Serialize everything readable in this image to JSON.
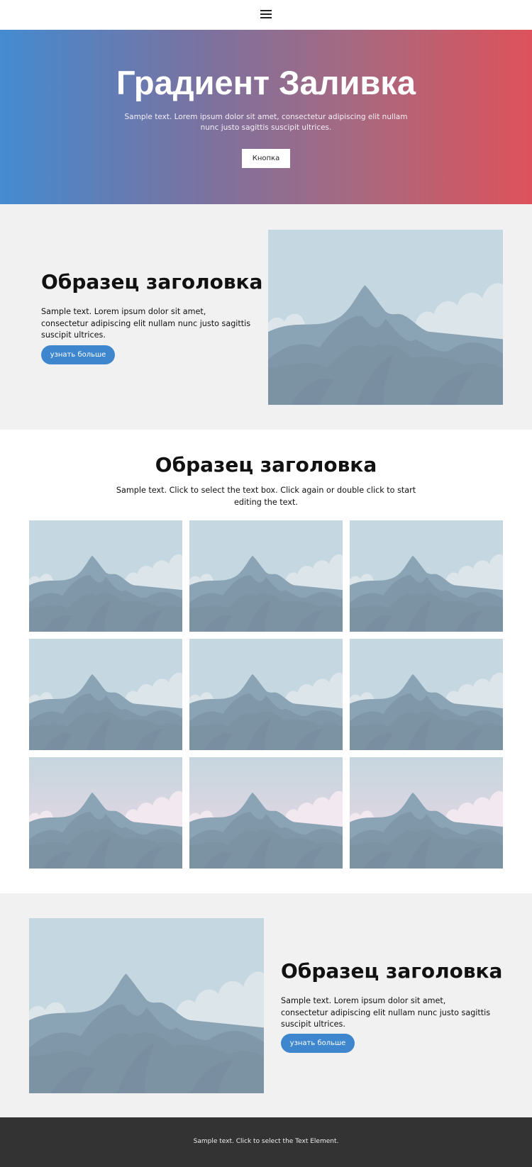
{
  "header": {
    "menu_icon": "hamburger-menu-icon"
  },
  "hero": {
    "title": "Градиент Заливка",
    "text": "Sample text. Lorem ipsum dolor sit amet, consectetur adipiscing elit nullam nunc justo sagittis suscipit ultrices.",
    "button_label": "Кнопка",
    "gradient_colors": [
      "#448bd0",
      "#dd525a"
    ]
  },
  "feature_left": {
    "title": "Образец заголовка",
    "text": "Sample text. Lorem ipsum dolor sit amet, consectetur adipiscing elit nullam nunc justo sagittis suscipit ultrices.",
    "button_label": "узнать больше",
    "image": "mountain-landscape-image"
  },
  "gallery_section": {
    "title": "Образец заголовка",
    "text": "Sample text. Click to select the text box. Click again or double click to start editing the text.",
    "tiles": [
      {
        "image": "mountain-landscape-image",
        "variant": "day"
      },
      {
        "image": "mountain-landscape-image",
        "variant": "day"
      },
      {
        "image": "mountain-landscape-image",
        "variant": "day"
      },
      {
        "image": "mountain-landscape-image",
        "variant": "day"
      },
      {
        "image": "mountain-landscape-image",
        "variant": "day"
      },
      {
        "image": "mountain-landscape-image",
        "variant": "day"
      },
      {
        "image": "mountain-landscape-image",
        "variant": "dusk"
      },
      {
        "image": "mountain-landscape-image",
        "variant": "dusk"
      },
      {
        "image": "mountain-landscape-image",
        "variant": "dusk"
      }
    ]
  },
  "feature_right": {
    "title": "Образец заголовка",
    "text": "Sample text. Lorem ipsum dolor sit amet, consectetur adipiscing elit nullam nunc justo sagittis suscipit ultrices.",
    "button_label": "узнать больше",
    "image": "mountain-landscape-image"
  },
  "footer": {
    "text": "Sample text. Click to select the Text Element."
  },
  "colors": {
    "accent_button": "#3e87cf",
    "section_gray": "#f1f1f1",
    "footer_bg": "#333333"
  }
}
